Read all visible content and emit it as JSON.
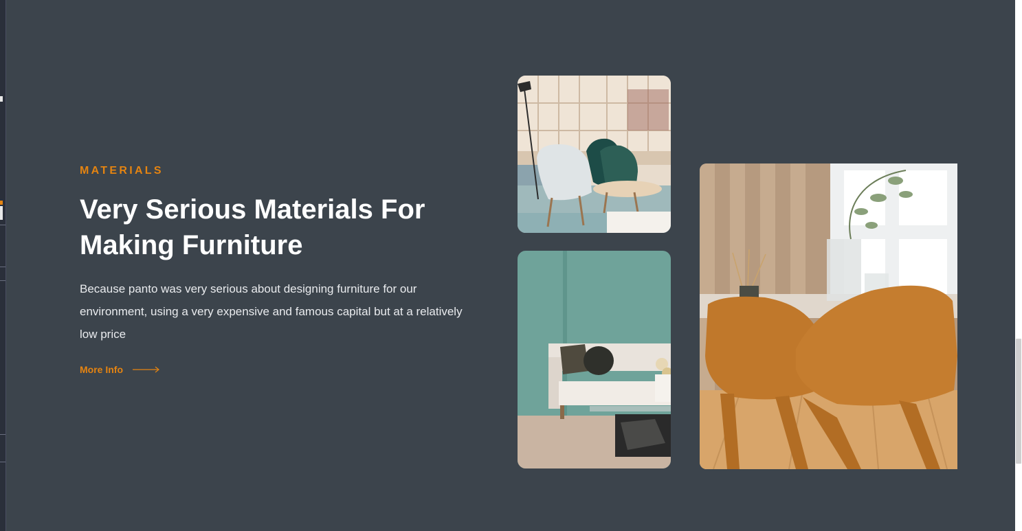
{
  "materials": {
    "eyebrow": "MATERIALS",
    "headline": "Very Serious Materials For Making Furniture",
    "description": "Because panto was very serious about designing furniture for our environment, using a very expensive and famous capital but at a relatively low price",
    "link_label": "More Info"
  },
  "colors": {
    "background": "#3c444c",
    "accent": "#e58411",
    "heading": "#ffffff",
    "body_text": "#e9ebee"
  },
  "icons": {
    "link_arrow": "arrow-right-icon"
  }
}
